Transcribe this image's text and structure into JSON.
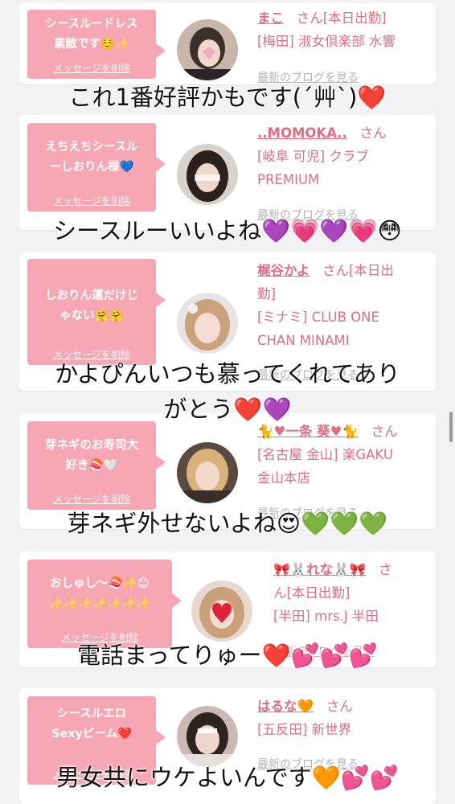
{
  "entries": [
    {
      "message": "シースルードレス素敵です☺️✨",
      "message_lines": [
        "シースルードレス",
        "素敵です☺️✨"
      ],
      "delete_label": "メッセージを削除",
      "name": "まこ",
      "suffix": "さん[本日出勤]",
      "info_lines": [
        "[梅田] 淑女倶楽部 水響"
      ],
      "blog_label": "最新のブログを見る",
      "caption_lines": [
        "これ1番好評かもです(´艸`)❤️"
      ]
    },
    {
      "message": "えちえちシースルーしおりん様💙",
      "message_lines": [
        "えちえちシースル",
        "ーしおりん様💙"
      ],
      "delete_label": "メッセージを削除",
      "name": "..MOMOKA..",
      "suffix": "さん",
      "info_lines": [
        "[岐阜 可児] クラブ",
        "PREMIUM"
      ],
      "blog_label": "最新のブログを見る",
      "caption_lines": [
        "シースルーいいよね💜💗💜💗😳"
      ]
    },
    {
      "message": "しおりん運だけじゃない🤗🤗",
      "message_lines": [
        "しおりん運だけじ",
        "ゃない🤗🤗"
      ],
      "delete_label": "メッセージを削除",
      "name": "梶谷かよ",
      "suffix": "さん[本日出勤]",
      "suffix_lines": [
        "さん[本日出",
        "勤]"
      ],
      "info_lines": [
        "[ミナミ] CLUB ONE",
        "CHAN MINAMI"
      ],
      "blog_label": "最新のブログを見る",
      "caption_lines": [
        "かよぴんいつも慕ってくれてあり",
        "がとう❤️💜"
      ]
    },
    {
      "message": "芽ネギのお寿司大好き🍣🤍",
      "message_lines": [
        "芽ネギのお寿司大",
        "好き🍣🤍"
      ],
      "delete_label": "メッセージを削除",
      "name": "🐈♥一条 葵♥🐈",
      "suffix": "さん",
      "info_lines": [
        "[名古屋 金山] 楽GAKU",
        "金山本店"
      ],
      "blog_label": "最新のブログを見る",
      "caption_lines": [
        "芽ネギ外せないよね😍💚💚💚"
      ]
    },
    {
      "message": "おしゅし〜🍣✨😊✨✨✨✨✨✨✨",
      "message_lines": [
        "おしゅし〜🍣✨😊",
        "✨✨✨✨✨✨✨"
      ],
      "delete_label": "メッセージを削除",
      "name": "🎀🐰れな🐰🎀",
      "suffix": "さん[本日出勤]",
      "suffix_lines": [
        "さ",
        "ん[本日出勤]"
      ],
      "info_lines": [
        "[半田] mrs.J 半田"
      ],
      "blog_label": "最新のブログを見る",
      "caption_lines": [
        "電話まってりゅー❤️💕💕💕"
      ]
    },
    {
      "message": "シースルエロSexyビーム❤️",
      "message_lines": [
        "シースルエロ",
        "Sexyビーム❤️"
      ],
      "delete_label": "メッセージを削除",
      "name": "はるな🧡",
      "suffix": "さん",
      "info_lines": [
        "[五反田] 新世界"
      ],
      "blog_label": "最新のブログを見る",
      "caption_lines": [
        "男女共にウケよいんです🧡💕💕"
      ]
    }
  ],
  "colors": {
    "background": "#f2f2f4",
    "card": "#ffffff",
    "bubble": "#f6a7b3",
    "name": "#e26d84",
    "blog_link": "#b3b3b3",
    "caption": "#111111"
  }
}
